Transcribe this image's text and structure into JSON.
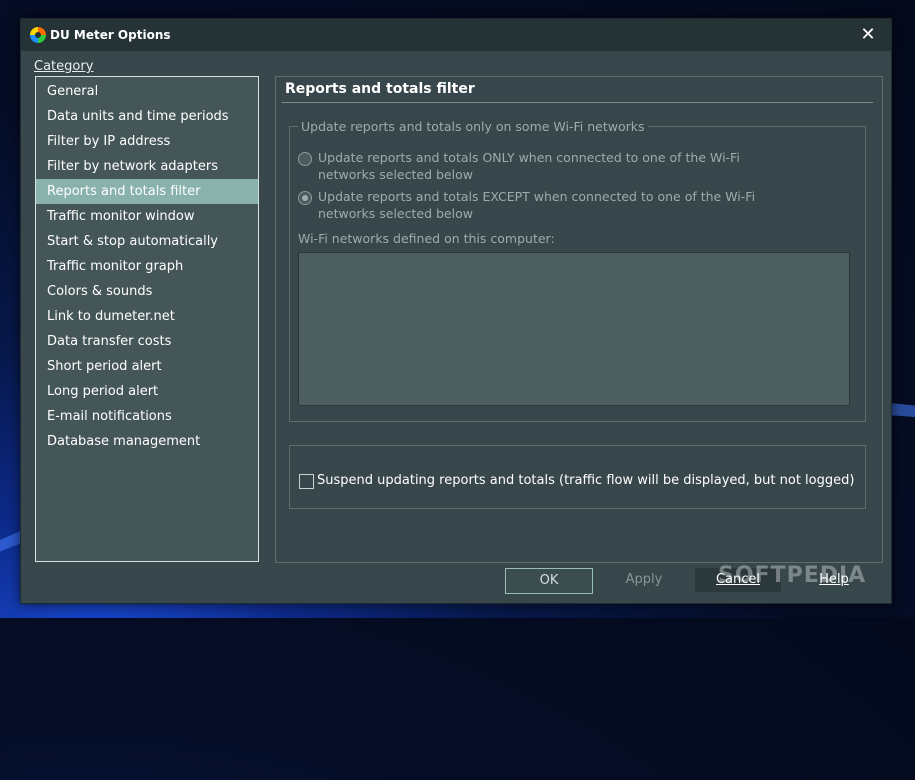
{
  "window": {
    "title": "DU Meter Options",
    "close_glyph": "✕"
  },
  "category": {
    "label": "Category",
    "items": [
      {
        "label": "General"
      },
      {
        "label": "Data units and time periods"
      },
      {
        "label": "Filter by IP address"
      },
      {
        "label": "Filter by network adapters"
      },
      {
        "label": "Reports and totals filter",
        "selected": true
      },
      {
        "label": "Traffic monitor window"
      },
      {
        "label": "Start & stop automatically"
      },
      {
        "label": "Traffic monitor graph"
      },
      {
        "label": "Colors & sounds"
      },
      {
        "label": "Link to dumeter.net"
      },
      {
        "label": "Data transfer costs"
      },
      {
        "label": "Short period alert"
      },
      {
        "label": "Long period alert"
      },
      {
        "label": "E-mail notifications"
      },
      {
        "label": "Database management"
      }
    ]
  },
  "panel": {
    "title": "Reports and totals filter",
    "wifi_group": {
      "legend": "Update reports and totals only on some Wi-Fi networks",
      "option_only": "Update reports and totals ONLY when connected to one of the Wi-Fi networks selected below",
      "option_except": "Update reports and totals EXCEPT when connected to one of the Wi-Fi networks selected below",
      "selected_option": "except",
      "networks_label": "Wi-Fi networks defined on this computer:"
    },
    "suspend_checkbox": {
      "label": "Suspend updating reports and totals (traffic flow will be displayed, but not logged)",
      "checked": false
    }
  },
  "buttons": {
    "ok": "OK",
    "apply": "Apply",
    "cancel": "Cancel",
    "help": "Help"
  },
  "watermark": "SOFTPEDIA",
  "colors": {
    "dialog_bg": "#37474b",
    "titlebar_bg": "#263336",
    "selected_item_bg": "#8ab2ad",
    "list_bg": "#455659"
  }
}
